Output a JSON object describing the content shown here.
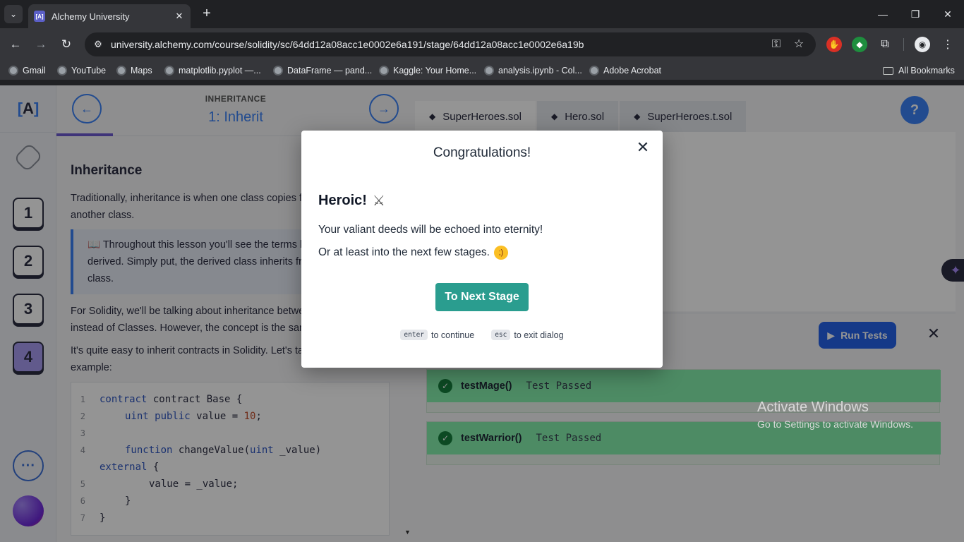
{
  "browser": {
    "tab_title": "Alchemy University",
    "url": "university.alchemy.com/course/solidity/sc/64dd12a08acc1e0002e6a191/stage/64dd12a08acc1e0002e6a19b",
    "bookmarks": [
      "Gmail",
      "YouTube",
      "Maps",
      "matplotlib.pyplot —...",
      "DataFrame — pand...",
      "Kaggle: Your Home...",
      "analysis.ipynb - Col...",
      "Adobe Acrobat"
    ],
    "all_bookmarks": "All Bookmarks"
  },
  "lesson": {
    "section": "INHERITANCE",
    "title": "1: Inherit",
    "heading": "Inheritance",
    "p1": "Traditionally, inheritance is when one class copies functionality from another class.",
    "callout": "📖 Throughout this lesson you'll see the terms base and derived. Simply put, the derived class inherits from the base class.",
    "p2": "For Solidity, we'll be talking about inheritance between Contracts instead of Classes. However, the concept is the same!",
    "p3": "It's quite easy to inherit contracts in Solidity. Let's take a look at an example:",
    "code": {
      "line1": "contract Base {",
      "line2_kw": "uint public",
      "line2_rest": " value = ",
      "line2_num": "10",
      "line2_end": ";",
      "line4_kw": "function",
      "line4_rest": " changeValue(",
      "line4_kw2": "uint",
      "line4_end": " _value)",
      "line4b_kw": "external",
      "line4b_end": " {",
      "line5": "value = _value;",
      "line6": "}",
      "line7": "}",
      "line_numbers": [
        "1",
        "2",
        "3",
        "4",
        "5",
        "6",
        "7"
      ]
    }
  },
  "rail": {
    "stages": [
      "1",
      "2",
      "3",
      "4"
    ],
    "more": "···",
    "logo": "A"
  },
  "editor": {
    "tabs": [
      "SuperHeroes.sol",
      "Hero.sol",
      "SuperHeroes.t.sol"
    ],
    "help": "?",
    "run_tests": "Run Tests",
    "tests": [
      {
        "name": "testMage()",
        "status": "Test Passed"
      },
      {
        "name": "testWarrior()",
        "status": "Test Passed"
      }
    ]
  },
  "watermark": {
    "title": "Activate Windows",
    "subtitle": "Go to Settings to activate Windows."
  },
  "modal": {
    "title": "Congratulations!",
    "heading": "Heroic!",
    "text1": "Your valiant deeds will be echoed into eternity!",
    "text2": "Or at least into the next few stages.",
    "button": "To Next Stage",
    "hint_enter_key": "enter",
    "hint_enter_text": "to continue",
    "hint_esc_key": "esc",
    "hint_esc_text": "to exit dialog"
  },
  "colors": {
    "accent_teal": "#2a9d8f",
    "accent_blue": "#3b82f6",
    "test_pass": "#86efac"
  }
}
